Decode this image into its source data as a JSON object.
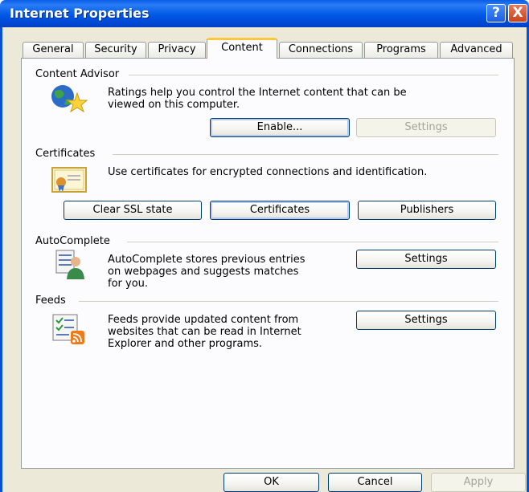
{
  "window": {
    "title": "Internet Properties"
  },
  "title_buttons": {
    "help": "?",
    "close": "X"
  },
  "tabs": [
    {
      "label": "General"
    },
    {
      "label": "Security"
    },
    {
      "label": "Privacy"
    },
    {
      "label": "Content"
    },
    {
      "label": "Connections"
    },
    {
      "label": "Programs"
    },
    {
      "label": "Advanced"
    }
  ],
  "active_tab": "Content",
  "content_advisor": {
    "title": "Content Advisor",
    "description_line1": "Ratings help you control the Internet content that can be",
    "description_line2": "viewed on this computer.",
    "enable_label": "Enable...",
    "settings_label": "Settings"
  },
  "certificates": {
    "title": "Certificates",
    "description": "Use certificates for encrypted connections and identification.",
    "clear_ssl_label": "Clear SSL state",
    "certificates_label": "Certificates",
    "publishers_label": "Publishers"
  },
  "autocomplete": {
    "title": "AutoComplete",
    "description_line1": "AutoComplete stores previous entries",
    "description_line2": "on webpages and suggests matches",
    "description_line3": "for you.",
    "settings_label": "Settings"
  },
  "feeds": {
    "title": "Feeds",
    "description_line1": "Feeds provide updated content from",
    "description_line2": "websites that can be read in Internet",
    "description_line3": "Explorer and other programs.",
    "settings_label": "Settings"
  },
  "footer": {
    "ok_label": "OK",
    "cancel_label": "Cancel",
    "apply_label": "Apply"
  }
}
